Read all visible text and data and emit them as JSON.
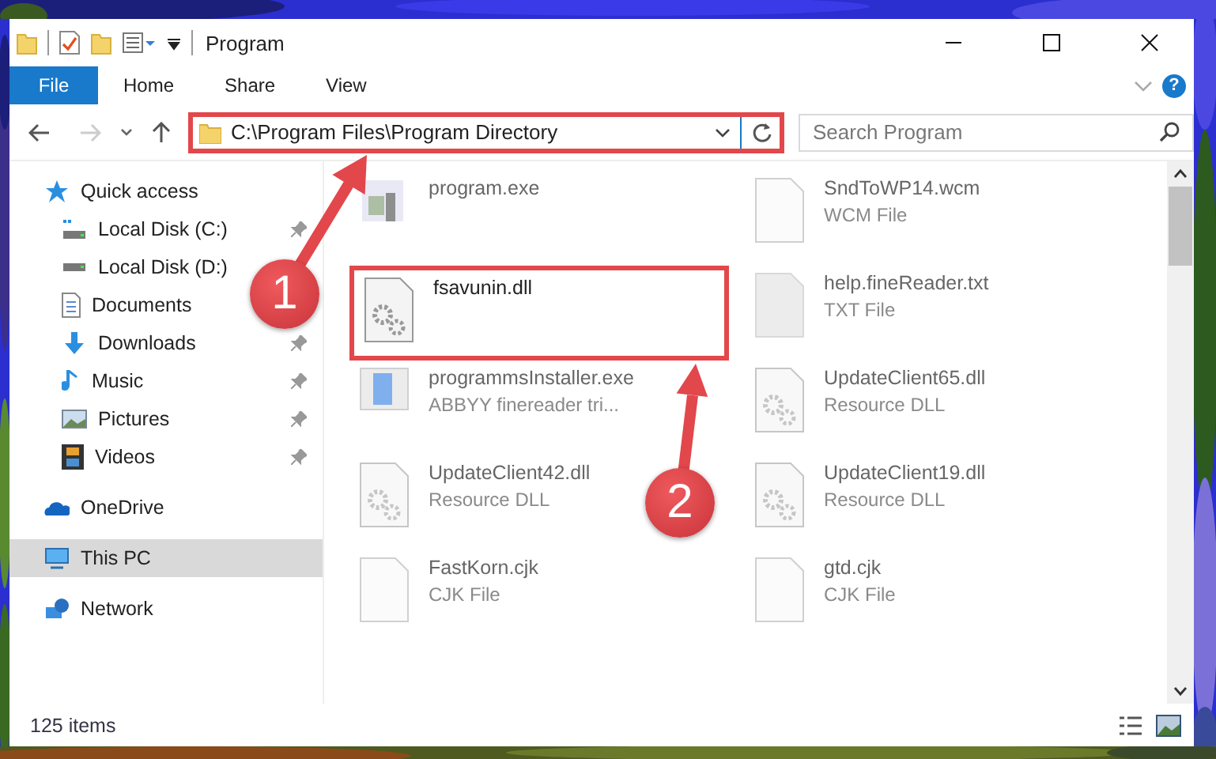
{
  "window": {
    "title": "Program"
  },
  "ribbon": {
    "tabs": [
      {
        "label": "File",
        "kind": "menu"
      },
      {
        "label": "Home",
        "kind": "tab"
      },
      {
        "label": "Share",
        "kind": "tab"
      },
      {
        "label": "View",
        "kind": "tab"
      }
    ],
    "help": "?"
  },
  "address": {
    "path": "C:\\Program Files\\Program Directory",
    "highlighted": true
  },
  "search": {
    "placeholder": "Search Program"
  },
  "sidebar": {
    "items": [
      {
        "label": "Quick access",
        "kind": "star",
        "selected": false,
        "children": [
          {
            "label": "Local Disk (C:)",
            "kind": "system-drive",
            "pinned": true,
            "selected": false
          },
          {
            "label": "Local Disk (D:)",
            "kind": "drive",
            "pinned": false,
            "selected": false
          },
          {
            "label": "Documents",
            "kind": "documents",
            "pinned": false,
            "selected": false
          },
          {
            "label": "Downloads",
            "kind": "downloads",
            "pinned": true,
            "selected": false
          },
          {
            "label": "Music",
            "kind": "music",
            "pinned": true,
            "selected": false
          },
          {
            "label": "Pictures",
            "kind": "pictures",
            "pinned": true,
            "selected": false
          },
          {
            "label": "Videos",
            "kind": "videos",
            "pinned": true,
            "selected": false
          }
        ]
      },
      {
        "label": "OneDrive",
        "kind": "cloud",
        "selected": false
      },
      {
        "label": "This PC",
        "kind": "computer",
        "selected": true
      },
      {
        "label": "Network",
        "kind": "network",
        "selected": false
      }
    ]
  },
  "files": [
    {
      "name": "program.exe",
      "kind": "exe",
      "blurred": true,
      "highlighted": false
    },
    {
      "name": "SndToWP14.wcm",
      "type": "WCM File",
      "kind": "blank",
      "blurred": true,
      "highlighted": false
    },
    {
      "name": "fsavunin.dll",
      "kind": "dll",
      "blurred": false,
      "highlighted": true
    },
    {
      "name": "help.fineReader.txt",
      "type": "TXT File",
      "kind": "txt",
      "blurred": true,
      "highlighted": false
    },
    {
      "name": "programmsInstaller.exe",
      "type": "ABBYY finereader tri...",
      "kind": "installer",
      "blurred": true,
      "highlighted": false
    },
    {
      "name": "UpdateClient65.dll",
      "type": "Resource DLL",
      "kind": "dll",
      "blurred": true,
      "highlighted": false
    },
    {
      "name": "UpdateClient42.dll",
      "type": "Resource DLL",
      "kind": "dll",
      "blurred": true,
      "highlighted": false
    },
    {
      "name": "UpdateClient19.dll",
      "type": "Resource DLL",
      "kind": "dll",
      "blurred": true,
      "highlighted": false
    },
    {
      "name": "FastKorn.cjk",
      "type": "CJK File",
      "kind": "blank",
      "blurred": true,
      "highlighted": false
    },
    {
      "name": "gtd.cjk",
      "type": "CJK File",
      "kind": "blank",
      "blurred": true,
      "highlighted": false
    }
  ],
  "status_bar": {
    "count": "125 items"
  },
  "annotations": [
    {
      "number": "1"
    },
    {
      "number": "2"
    }
  ]
}
